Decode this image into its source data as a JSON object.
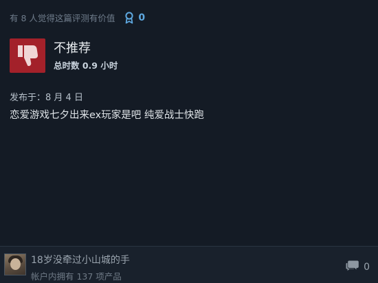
{
  "helpful": {
    "text": "有 8 人觉得这篇评测有价值",
    "award_icon": "award-ribbon-icon",
    "award_count": "0",
    "award_color": "#5ea8e0"
  },
  "verdict": {
    "icon": "thumbs-down-icon",
    "icon_bg": "#a3212a",
    "title": "不推荐",
    "hours": "总时数 0.9 小时"
  },
  "review": {
    "posted": "发布于：8 月 4 日",
    "text": "恋爱游戏七夕出来ex玩家是吧 纯爱战士快跑"
  },
  "footer": {
    "username": "18岁没牵过小山城的手",
    "products": "帐户内拥有 137 项产品",
    "comment_icon": "comment-bubble-icon",
    "comment_count": "0"
  }
}
